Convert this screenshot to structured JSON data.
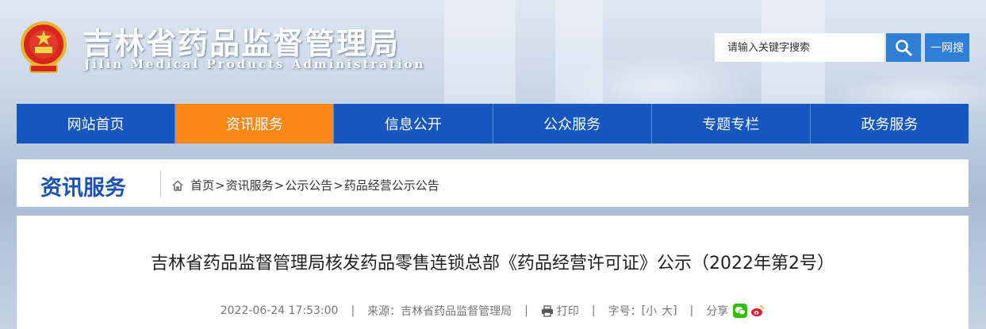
{
  "header": {
    "site_title": "吉林省药品监督管理局",
    "site_subtitle": "Jilin Medical Products Administration"
  },
  "search": {
    "placeholder": "请输入关键字搜索",
    "yiwang_label": "一网搜"
  },
  "nav": {
    "items": [
      {
        "label": "网站首页"
      },
      {
        "label": "资讯服务"
      },
      {
        "label": "信息公开"
      },
      {
        "label": "公众服务"
      },
      {
        "label": "专题专栏"
      },
      {
        "label": "政务服务"
      }
    ],
    "active_index": 1
  },
  "section": {
    "title": "资讯服务",
    "breadcrumb": [
      "首页",
      "资讯服务",
      "公示公告",
      "药品经营公示公告"
    ],
    "separator": ">"
  },
  "article": {
    "title": "吉林省药品监督管理局核发药品零售连锁总部《药品经营许可证》公示（2022年第2号）",
    "datetime": "2022-06-24 17:53:00",
    "source_label": "来源：",
    "source": "吉林省药品监督管理局",
    "print_label": "打印",
    "fontsize_label": "字号：",
    "fontsize_open": "[",
    "fontsize_small": "小",
    "fontsize_large": "大",
    "fontsize_close": "]",
    "share_label": "分享"
  },
  "colors": {
    "nav_bg": "#1656bf",
    "nav_active": "#fa8716",
    "search_btn": "#2f7fd6",
    "section_title": "#1b52b5",
    "wechat": "#2dc100",
    "weibo": "#e6162d"
  }
}
